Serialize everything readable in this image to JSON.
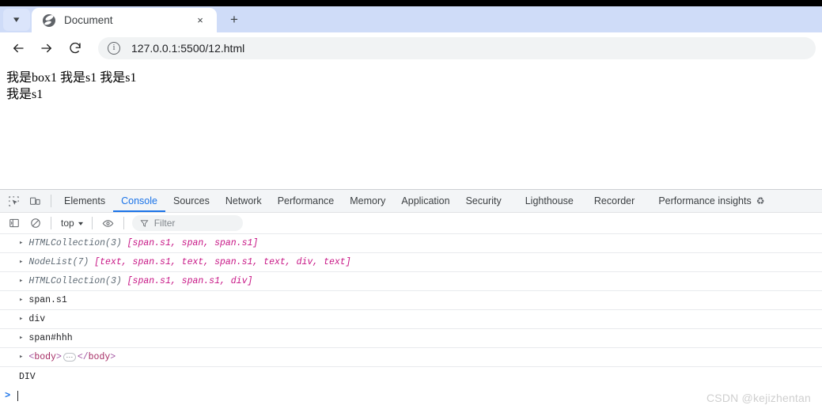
{
  "browser": {
    "tab": {
      "title": "Document",
      "favicon": "globe-icon",
      "close_label": "×"
    },
    "tab_list_chevron": "▾",
    "new_tab_label": "+",
    "nav": {
      "back": "back-arrow-icon",
      "forward": "forward-arrow-icon",
      "reload": "reload-icon"
    },
    "omnibox": {
      "site_info_icon": "info-circle-icon",
      "url": "127.0.0.1:5500/12.html"
    }
  },
  "page": {
    "lines": [
      "我是box1 我是s1 我是s1",
      "我是s1"
    ]
  },
  "devtools": {
    "left_icons": [
      "inspect-element-icon",
      "device-toolbar-icon"
    ],
    "tabs": [
      {
        "label": "Elements",
        "active": false
      },
      {
        "label": "Console",
        "active": true
      },
      {
        "label": "Sources",
        "active": false
      },
      {
        "label": "Network",
        "active": false
      },
      {
        "label": "Performance",
        "active": false
      },
      {
        "label": "Memory",
        "active": false
      },
      {
        "label": "Application",
        "active": false
      },
      {
        "label": "Security",
        "active": false
      },
      {
        "label": "Lighthouse",
        "active": false
      },
      {
        "label": "Recorder",
        "active": false
      },
      {
        "label": "Performance insights",
        "active": false,
        "icon": "flask-icon"
      }
    ],
    "toolbar": {
      "sidebar_toggle_icon": "console-sidebar-icon",
      "clear_console_icon": "clear-console-icon",
      "context_label": "top",
      "context_caret": "▾",
      "eye_icon": "live-expression-eye-icon",
      "filter_icon": "filter-funnel-icon",
      "filter_placeholder": "Filter"
    },
    "console_rows": [
      {
        "type": "object",
        "expand_arrow": "▸",
        "name": "HTMLCollection(3)",
        "body": " [span.s1, span, span.s1]"
      },
      {
        "type": "object",
        "expand_arrow": "▸",
        "name": "NodeList(7)",
        "body": " [text, span.s1, text, span.s1, text, div, text]"
      },
      {
        "type": "object",
        "expand_arrow": "▸",
        "name": "HTMLCollection(3)",
        "body": " [span.s1, span.s1, div]"
      },
      {
        "type": "node",
        "expand_arrow": "▸",
        "name": "span.s1"
      },
      {
        "type": "node",
        "expand_arrow": "▸",
        "name": "div"
      },
      {
        "type": "node",
        "expand_arrow": "▸",
        "name": "span#hhh"
      },
      {
        "type": "element",
        "expand_arrow": "▸",
        "open_lt": "<",
        "open_tag": "body",
        "open_gt": ">",
        "ellipsis": "···",
        "close_lt": "</",
        "close_tag": "body",
        "close_gt": ">"
      }
    ],
    "plain_output": "DIV",
    "prompt": {
      "caret": ">",
      "value": ""
    }
  },
  "watermark": "CSDN @kejizhentan"
}
